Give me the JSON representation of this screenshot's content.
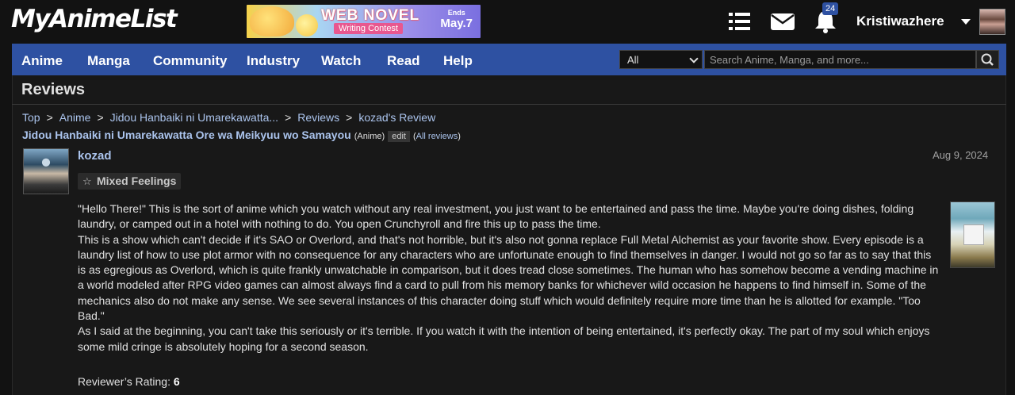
{
  "header": {
    "logo": "MyAnimeList",
    "banner": {
      "title": "WEB NOVEL",
      "subtitle": "Writing Contest",
      "ends_label": "Ends",
      "ends_date": "May.7"
    },
    "notification_count": "24",
    "username": "Kristiwazhere"
  },
  "nav": {
    "items": [
      "Anime",
      "Manga",
      "Community",
      "Industry",
      "Watch",
      "Read",
      "Help"
    ],
    "search_select": "All",
    "search_placeholder": "Search Anime, Manga, and more..."
  },
  "page": {
    "title": "Reviews",
    "breadcrumbs": [
      "Top",
      "Anime",
      "Jidou Hanbaiki ni Umarekawatta...",
      "Reviews",
      "kozad's Review"
    ],
    "anime_title": "Jidou Hanbaiki ni Umarekawatta Ore wa Meikyuu wo Samayou",
    "anime_type": "(Anime)",
    "edit_label": "edit",
    "all_reviews_open": "(",
    "all_reviews_link": "All reviews",
    "all_reviews_close": ")"
  },
  "review": {
    "reviewer": "kozad",
    "date": "Aug 9, 2024",
    "tag": "Mixed Feelings",
    "paragraphs": [
      "\"Hello There!\" This is the sort of anime which you watch without any real investment, you just want to be entertained and pass the time. Maybe you're doing dishes, folding laundry, or camped out in a hotel with nothing to do. You open Crunchyroll and fire this up to pass the time.",
      "This is a show which can't decide if it's SAO or Overlord, and that's not horrible, but it's also not gonna replace Full Metal Alchemist as your favorite show. Every episode is a laundry list of how to use plot armor with no consequence for any characters who are unfortunate enough to find themselves in danger. I would not go so far as to say that this is as egregious as Overlord, which is quite frankly unwatchable in comparison, but it does tread close sometimes. The human who has somehow become a vending machine in a world modeled after RPG video games can almost always find a card to pull from his memory banks for whichever wild occasion he happens to find himself in. Some of the mechanics also do not make any sense. We see several instances of this character doing stuff which would definitely require more time than he is allotted for example. \"Too Bad.\"",
      "As I said at the beginning, you can't take this seriously or it's terrible. If you watch it with the intention of being entertained, it's perfectly okay. The part of my soul which enjoys some mild cringe is absolutely hoping for a second season."
    ],
    "rating_label": "Reviewer’s Rating:",
    "rating_value": "6"
  },
  "icons": [
    "list-icon",
    "mail-icon",
    "bell-icon",
    "search-icon",
    "star-icon",
    "caret-down-icon"
  ],
  "colors": {
    "accent": "#2e51a2",
    "link": "#abc4ed",
    "background": "#121212",
    "panel": "#181818"
  }
}
